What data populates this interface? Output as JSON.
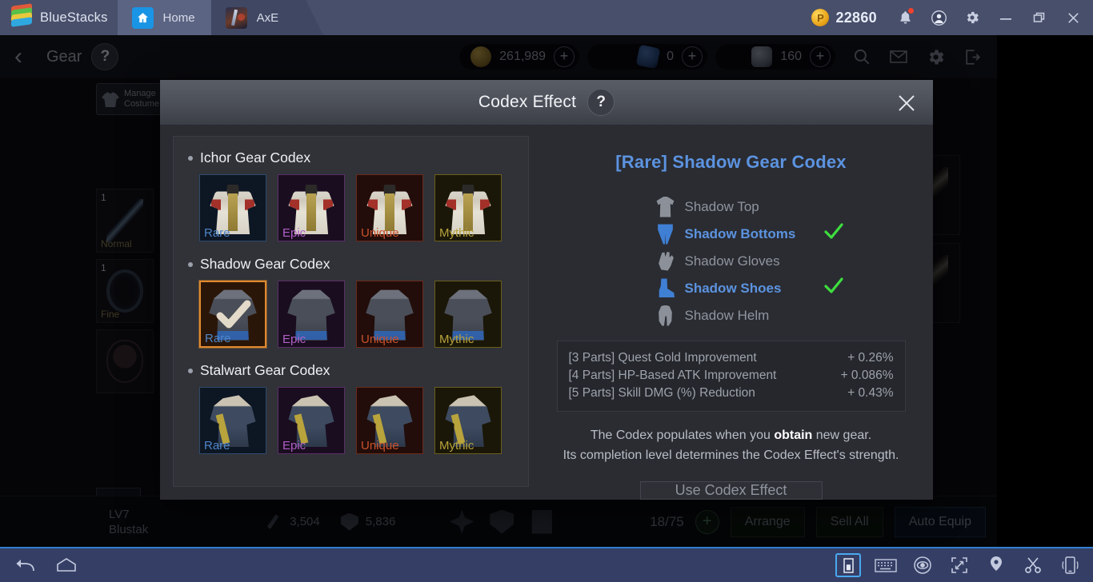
{
  "bluestacks": {
    "brand": "BlueStacks",
    "tabs": [
      {
        "label": "Home",
        "icon": "home-icon"
      },
      {
        "label": "AxE",
        "icon": "app-icon"
      }
    ],
    "points_value": "22860",
    "points_icon": "bluestacks-points-coin-icon",
    "window_controls": {
      "notifications": "bell-icon",
      "account": "account-icon",
      "settings": "gear-icon",
      "minimize": "minimize-icon",
      "maximize": "maximize-icon",
      "close": "close-icon"
    }
  },
  "game_header": {
    "back_icon": "back-chevron-icon",
    "title": "Gear",
    "help_label": "?",
    "currencies": [
      {
        "icon": "gold-coin-icon",
        "value": "261,989",
        "plus": "+"
      },
      {
        "icon": "gem-icon",
        "value": "0",
        "plus": "+"
      },
      {
        "icon": "ore-icon",
        "value": "160",
        "plus": "+"
      }
    ],
    "actions": [
      "search-icon",
      "mail-icon",
      "settings-gear-icon",
      "exit-icon"
    ]
  },
  "game_left_panel": {
    "manage_costume_label": "Manage Costume",
    "slots": [
      {
        "qty": "1",
        "grade": "Normal",
        "art": "sword"
      },
      {
        "qty": "1",
        "grade": "Fine",
        "art": "ring"
      },
      {
        "qty": "",
        "grade": "",
        "art": "pend"
      }
    ]
  },
  "game_bottom": {
    "level": "LV7",
    "name": "Blustak",
    "atk": "3,504",
    "def": "5,836",
    "capacity": "18/75",
    "capacity_plus": "+",
    "buttons": [
      "Arrange",
      "Sell All",
      "Auto Equip"
    ]
  },
  "modal": {
    "title": "Codex Effect",
    "help_label": "?",
    "close_icon": "close-icon",
    "codex_groups": [
      {
        "name": "Ichor Gear Codex",
        "art": "robe",
        "tiers": [
          {
            "label": "Rare",
            "color": "#4e86c9",
            "border": "#2f4a6b",
            "bg": "#0d1623",
            "selected": false,
            "owned": false
          },
          {
            "label": "Epic",
            "color": "#b05fc6",
            "border": "#5a2f66",
            "bg": "#1a0d20",
            "selected": false,
            "owned": false
          },
          {
            "label": "Unique",
            "color": "#c9522c",
            "border": "#6b2a1a",
            "bg": "#220d0a",
            "selected": false,
            "owned": false
          },
          {
            "label": "Mythic",
            "color": "#b8a33c",
            "border": "#6b5e1c",
            "bg": "#1a1708",
            "selected": false,
            "owned": false
          }
        ]
      },
      {
        "name": "Shadow Gear Codex",
        "art": "dark",
        "tiers": [
          {
            "label": "Rare",
            "color": "#4e86c9",
            "border": "#e08a2e",
            "bg": "#2a1608",
            "selected": true,
            "owned": true
          },
          {
            "label": "Epic",
            "color": "#b05fc6",
            "border": "#5a2f66",
            "bg": "#1a0d20",
            "selected": false,
            "owned": false
          },
          {
            "label": "Unique",
            "color": "#c9522c",
            "border": "#6b2a1a",
            "bg": "#220d0a",
            "selected": false,
            "owned": false
          },
          {
            "label": "Mythic",
            "color": "#b8a33c",
            "border": "#6b5e1c",
            "bg": "#1a1708",
            "selected": false,
            "owned": false
          }
        ]
      },
      {
        "name": "Stalwart Gear Codex",
        "art": "blue",
        "tiers": [
          {
            "label": "Rare",
            "color": "#4e86c9",
            "border": "#2f4a6b",
            "bg": "#0d1623",
            "selected": false,
            "owned": false
          },
          {
            "label": "Epic",
            "color": "#b05fc6",
            "border": "#5a2f66",
            "bg": "#1a0d20",
            "selected": false,
            "owned": false
          },
          {
            "label": "Unique",
            "color": "#c9522c",
            "border": "#6b2a1a",
            "bg": "#220d0a",
            "selected": false,
            "owned": false
          },
          {
            "label": "Mythic",
            "color": "#b8a33c",
            "border": "#6b5e1c",
            "bg": "#1a1708",
            "selected": false,
            "owned": false
          }
        ]
      }
    ],
    "detail": {
      "title": "[Rare] Shadow Gear Codex",
      "title_color": "#5c93e0",
      "parts": [
        {
          "name": "Shadow Top",
          "icon": "shadow-top-icon",
          "obtained": false
        },
        {
          "name": "Shadow Bottoms",
          "icon": "shadow-bottoms-icon",
          "obtained": true
        },
        {
          "name": "Shadow Gloves",
          "icon": "shadow-gloves-icon",
          "obtained": false
        },
        {
          "name": "Shadow Shoes",
          "icon": "shadow-shoes-icon",
          "obtained": true
        },
        {
          "name": "Shadow Helm",
          "icon": "shadow-helm-icon",
          "obtained": false
        }
      ],
      "check_color": "#3ede3e",
      "effects": [
        {
          "label": "[3 Parts] Quest Gold Improvement",
          "value": "+ 0.26%"
        },
        {
          "label": "[4 Parts] HP-Based ATK Improvement",
          "value": "+ 0.086%"
        },
        {
          "label": "[5 Parts] Skill DMG (%) Reduction",
          "value": "+ 0.43%"
        }
      ],
      "description_line1_pre": "The Codex populates when you ",
      "description_line1_bold": "obtain",
      "description_line1_post": " new gear.",
      "description_line2": "Its completion level determines the Codex Effect's strength.",
      "use_button": "Use Codex Effect"
    }
  },
  "taskbar": {
    "left": [
      "back-icon",
      "home-icon"
    ],
    "right": [
      "app-drawer-icon",
      "keyboard-icon",
      "eye-macro-icon",
      "fullscreen-icon",
      "location-icon",
      "scissors-screenshot-icon",
      "shake-device-icon"
    ]
  }
}
